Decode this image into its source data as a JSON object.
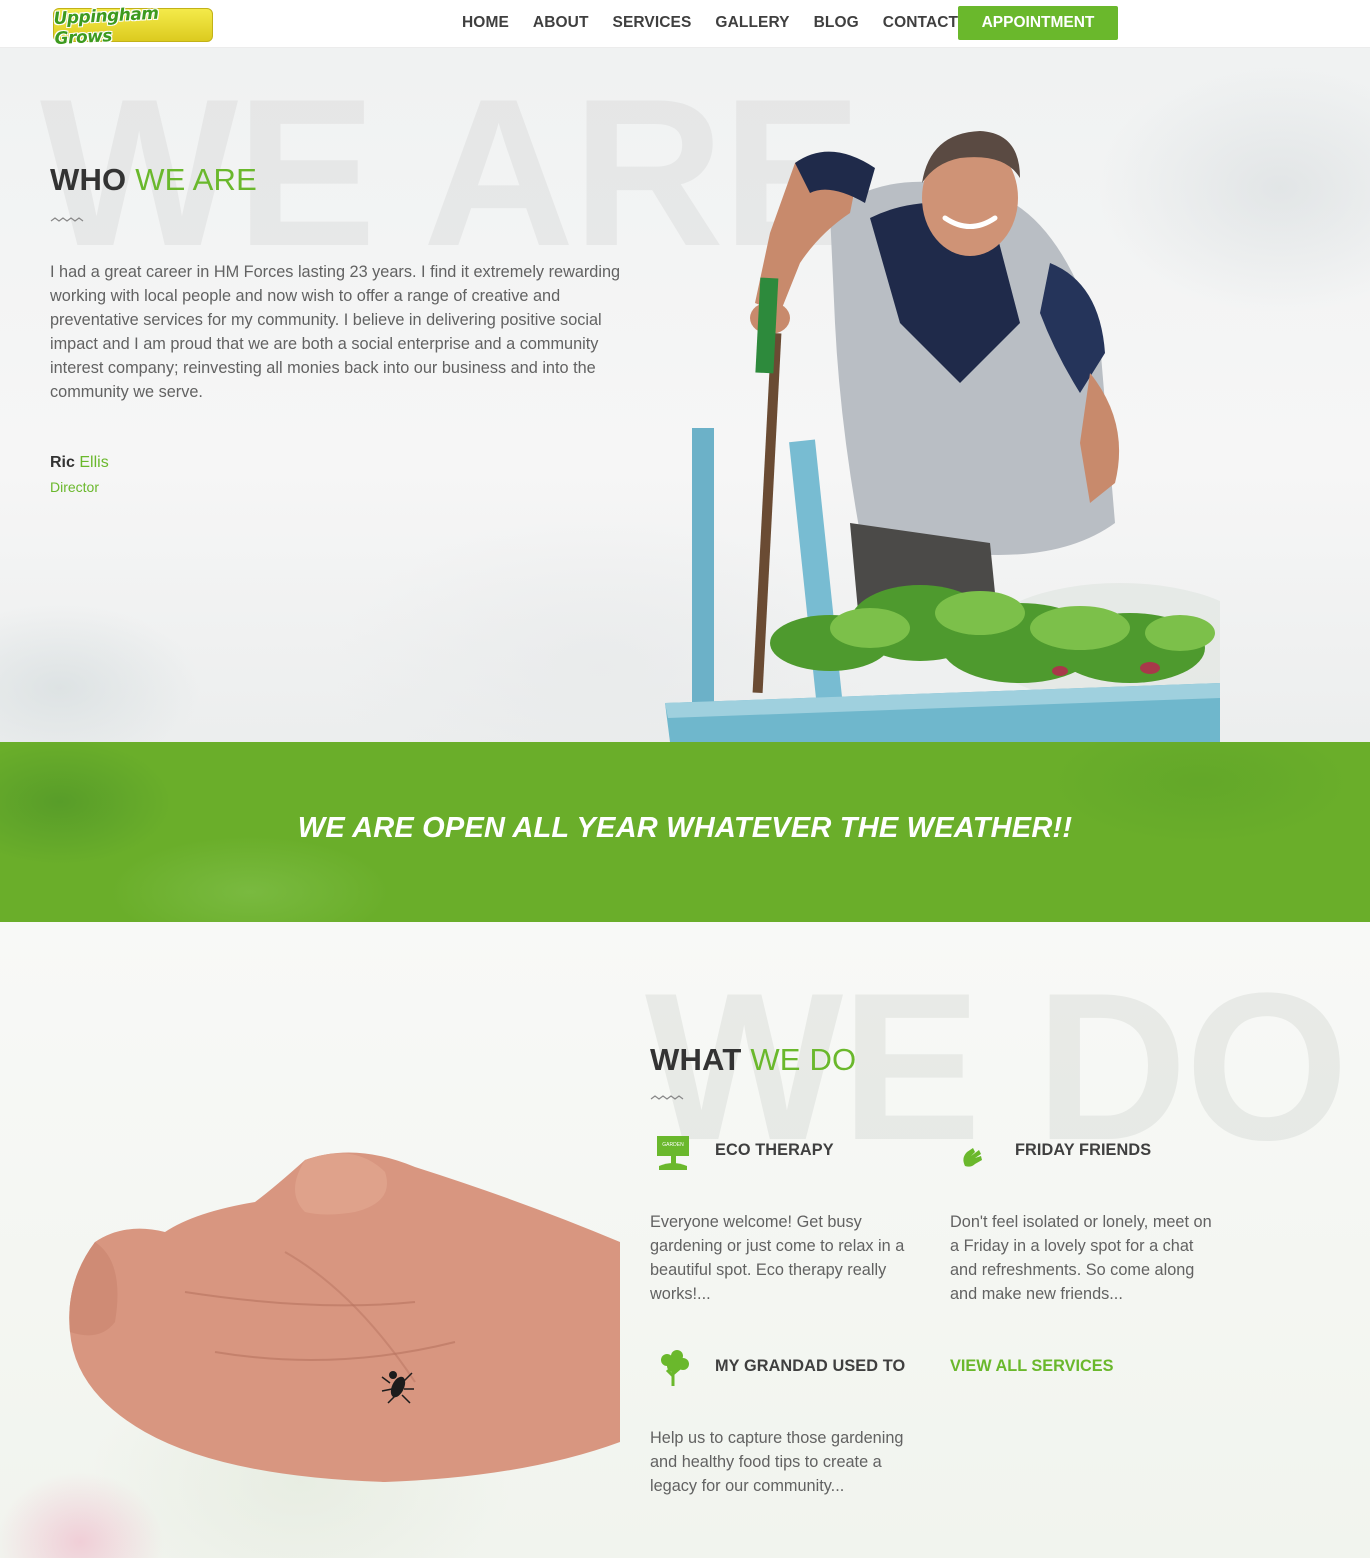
{
  "header": {
    "logo_text": "Uppingham Grows",
    "nav": [
      {
        "label": "HOME"
      },
      {
        "label": "ABOUT"
      },
      {
        "label": "SERVICES"
      },
      {
        "label": "GALLERY"
      },
      {
        "label": "BLOG"
      },
      {
        "label": "CONTACT"
      }
    ],
    "cta_label": "APPOINTMENT"
  },
  "about": {
    "bg_word": "WE ARE",
    "title_dark": "WHO",
    "title_accent": "WE ARE",
    "paragraph": "I had a great career in HM Forces lasting 23 years. I find it extremely rewarding working with local people and now wish to offer a range of creative and preventative services for my community. I believe in delivering positive social impact and I am proud that we are both a social enterprise and a community interest company; reinvesting all monies back into our business and into the community we serve.",
    "signature_first": "Ric",
    "signature_last": "Ellis",
    "signature_role": "Director"
  },
  "banner": {
    "text": "WE ARE OPEN ALL YEAR WHATEVER THE WEATHER!!"
  },
  "services": {
    "bg_word": "WE DO",
    "title_dark": "WHAT",
    "title_accent": "WE DO",
    "items": [
      {
        "icon": "garden-sign-icon",
        "sign_text": "GARDEN",
        "title": "ECO THERAPY",
        "text": "Everyone welcome! Get busy gardening or just come to relax in a beautiful spot. Eco therapy really works!..."
      },
      {
        "icon": "hands-icon",
        "title": "FRIDAY FRIENDS",
        "text": "Don't feel isolated or lonely, meet on a Friday in a lovely spot for a chat and refreshments. So come along and make new friends..."
      },
      {
        "icon": "broccoli-icon",
        "title": "MY GRANDAD USED TO",
        "text": "Help us to capture those gardening and healthy food tips to create a legacy for our community..."
      }
    ],
    "view_all": "VIEW ALL SERVICES"
  },
  "colors": {
    "accent": "#6ab82c",
    "heading": "#333333",
    "body_text": "#626262",
    "banner_bg": "#6aae2a"
  }
}
